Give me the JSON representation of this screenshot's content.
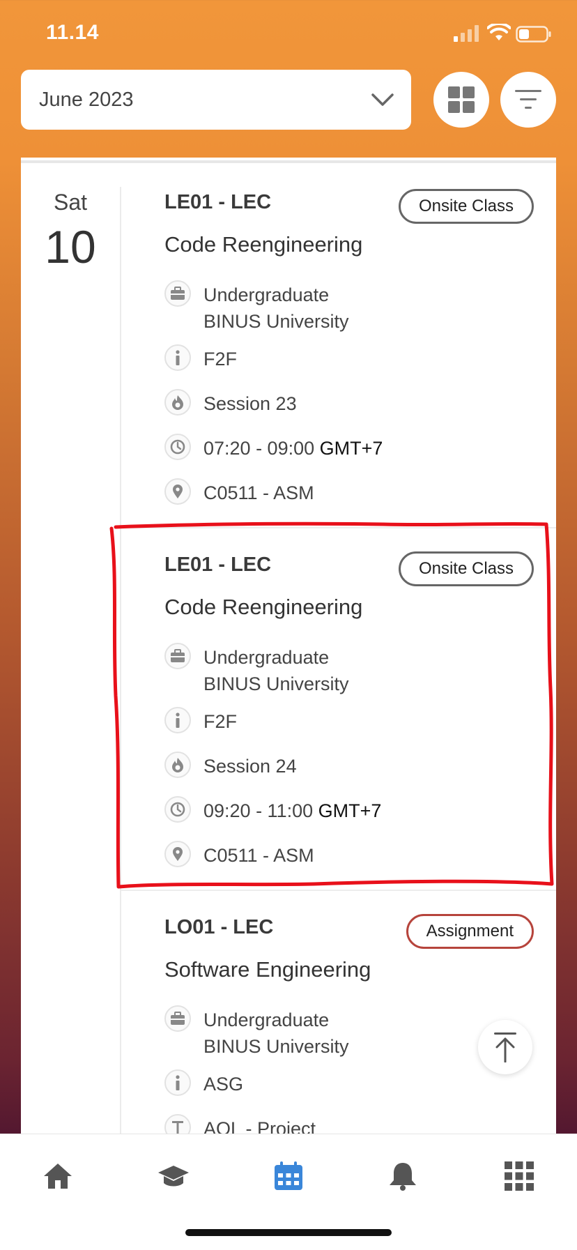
{
  "status_bar": {
    "time": "11.14"
  },
  "header": {
    "month_label": "June 2023"
  },
  "day": {
    "name": "Sat",
    "number": "10"
  },
  "entries": [
    {
      "code": "LE01 - LEC",
      "badge": "Onsite Class",
      "title": "Code Reengineering",
      "career_line1": "Undergraduate",
      "career_line2": "BINUS University",
      "delivery": "F2F",
      "session": "Session 23",
      "time": "07:20 - 09:00",
      "timezone": "GMT+7",
      "room": "C0511 - ASM"
    },
    {
      "code": "LE01 - LEC",
      "badge": "Onsite Class",
      "title": "Code Reengineering",
      "career_line1": "Undergraduate",
      "career_line2": "BINUS University",
      "delivery": "F2F",
      "session": "Session 24",
      "time": "09:20 - 11:00",
      "timezone": "GMT+7",
      "room": "C0511 - ASM"
    },
    {
      "code": "LO01 - LEC",
      "badge": "Assignment",
      "title": "Software Engineering",
      "career_line1": "Undergraduate",
      "career_line2": "BINUS University",
      "delivery": "ASG",
      "task": "AOL - Project"
    }
  ],
  "colors": {
    "accent": "#F1963A",
    "nav_active": "#3A86D9",
    "nav_inactive": "#555555",
    "annotation": "#E8101A",
    "assignment_border": "#B6443C"
  },
  "icons": {
    "career": "briefcase-icon",
    "delivery": "info-icon",
    "session": "flame-icon",
    "time": "clock-icon",
    "room": "location-pin-icon",
    "task": "text-icon"
  }
}
